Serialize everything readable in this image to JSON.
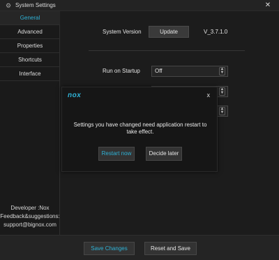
{
  "window": {
    "title": "System Settings",
    "gear_icon": "gear-icon",
    "close_icon": "close-icon"
  },
  "sidebar": {
    "items": [
      {
        "label": "General",
        "active": true
      },
      {
        "label": "Advanced",
        "active": false
      },
      {
        "label": "Properties",
        "active": false
      },
      {
        "label": "Shortcuts",
        "active": false
      },
      {
        "label": "Interface",
        "active": false
      }
    ],
    "developer": "Developer :Nox",
    "feedback": "Feedback&suggestions:",
    "email": "support@bignox.com"
  },
  "general": {
    "system_version_label": "System Version",
    "update_button": "Update",
    "version": "V_3.7.1.0",
    "run_on_startup_label": "Run on Startup",
    "run_on_startup_value": "Off"
  },
  "footer": {
    "save_label": "Save Changes",
    "reset_label": "Reset and Save"
  },
  "dialog": {
    "logo": "nox",
    "close_glyph": "x",
    "message": "Settings you have changed need application restart to take effect.",
    "restart_label": "Restart now",
    "later_label": "Decide later"
  },
  "colors": {
    "accent": "#2fb2d6",
    "background": "#1d1d1d"
  }
}
